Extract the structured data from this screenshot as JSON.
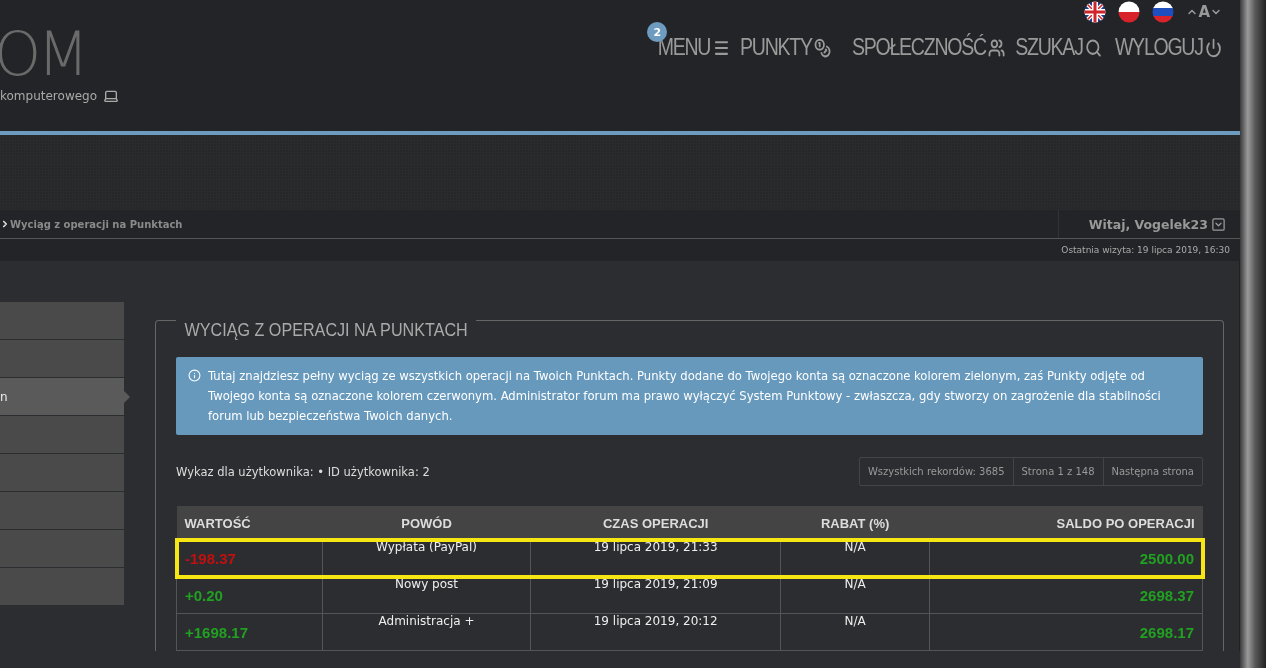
{
  "header": {
    "logo": "OM",
    "tagline": "komputerowego",
    "languages": [
      {
        "kind": "uk"
      },
      {
        "kind": "pl"
      },
      {
        "kind": "ru"
      }
    ],
    "font_size_label": "A",
    "nav": [
      {
        "label": "MENU",
        "kind": "menu",
        "badge": "2"
      },
      {
        "label": "PUNKTY",
        "kind": "points"
      },
      {
        "label": "SPOŁECZNOŚĆ",
        "kind": "community"
      },
      {
        "label": "SZUKAJ",
        "kind": "search"
      },
      {
        "label": "WYLOGUJ",
        "kind": "logout"
      }
    ]
  },
  "breadcrumb": "Wyciąg z operacji na Punktach",
  "user": {
    "greeting": "Witaj, Vogelek23",
    "last_visit": "Ostatnia wizyta: 19 lipca 2019, 16:30"
  },
  "sidebar": {
    "items": [
      {
        "selected": false
      },
      {
        "selected": false
      },
      {
        "label": "n",
        "selected": true
      },
      {
        "selected": false
      },
      {
        "selected": false
      },
      {
        "selected": false
      },
      {
        "selected": false
      },
      {
        "selected": false
      }
    ]
  },
  "panel": {
    "title": "WYCIĄG Z OPERACJI NA PUNKTACH",
    "info": "Tutaj znajdziesz pełny wyciąg ze wszystkich operacji na Twoich Punktach. Punkty dodane do Twojego konta są oznaczone kolorem zielonym, zaś Punkty odjęte od Twojego konta są oznaczone kolorem czerwonym. Administrator forum ma prawo wyłączyć System Punktowy - zwłaszcza, gdy stworzy on zagrożenie dla stabilności forum lub bezpieczeństwa Twoich danych.",
    "user_line": "Wykaz dla użytkownika: • ID użytkownika: 2",
    "pagination": [
      "Wszystkich rekordów: 3685",
      "Strona 1 z 148",
      "Następna strona"
    ],
    "table": {
      "columns": [
        "WARTOŚĆ",
        "POWÓD",
        "CZAS OPERACJI",
        "RABAT (%)",
        "SALDO PO OPERACJI"
      ],
      "rows": [
        {
          "value": "-198.37",
          "kind": "debit",
          "reason": "Wypłata (PayPal)",
          "time": "19 lipca 2019, 21:33",
          "discount": "N/A",
          "balance": "2500.00",
          "highlighted": true
        },
        {
          "value": "+0.20",
          "kind": "credit",
          "reason": "Nowy post",
          "time": "19 lipca 2019, 21:09",
          "discount": "N/A",
          "balance": "2698.37",
          "highlighted": false
        },
        {
          "value": "+1698.17",
          "kind": "credit",
          "reason": "Administracja +",
          "time": "19 lipca 2019, 20:12",
          "discount": "N/A",
          "balance": "2698.17",
          "highlighted": false
        }
      ]
    }
  }
}
